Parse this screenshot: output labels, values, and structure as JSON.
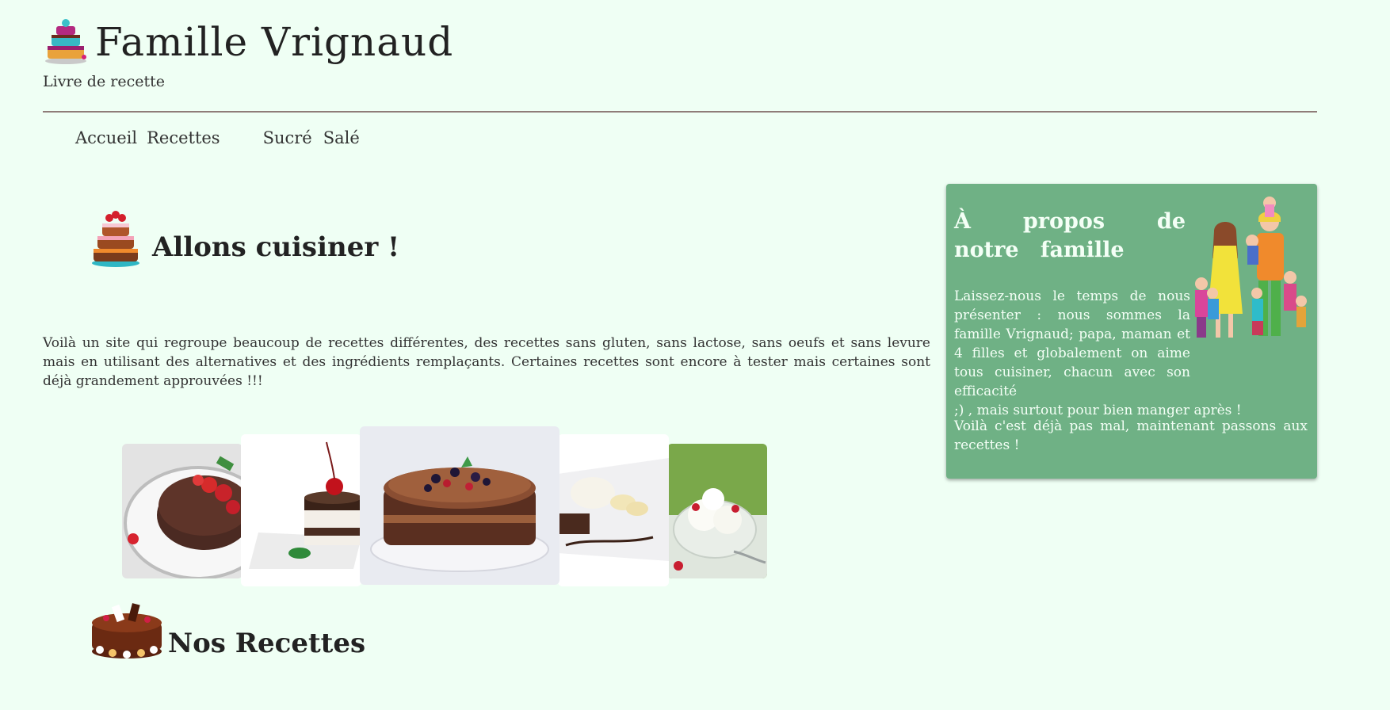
{
  "header": {
    "title": "Famille Vrignaud",
    "tagline": "Livre de recette"
  },
  "nav": {
    "items": [
      "Accueil",
      "Recettes",
      "Sucré",
      "Salé"
    ]
  },
  "intro": {
    "title": "Allons cuisiner !",
    "text": "Voilà un site qui regroupe beaucoup de recettes différentes, des recettes sans gluten, sans lactose, sans oeufs et sans levure mais en utilisant des alternatives et des ingrédients remplaçants. Certaines recettes sont encore à tester mais certaines sont déjà grandement approuvées !!!"
  },
  "recipes": {
    "title": "Nos Recettes"
  },
  "about": {
    "title": "À propos de notre famille",
    "p1_part1": "Laissez-nous le temps de nous présenter : nous sommes la famille Vrignaud; papa, maman et 4 filles et globalement on aime tous cuisiner, chacun avec son efficacité",
    "p1_part2": ";) , mais surtout pour bien manger après !",
    "p2": "Voilà c'est déjà pas mal, maintenant passons aux recettes !"
  },
  "colors": {
    "background": "#effff4",
    "about_panel": "#6fb185",
    "rule": "#8f7c78"
  }
}
